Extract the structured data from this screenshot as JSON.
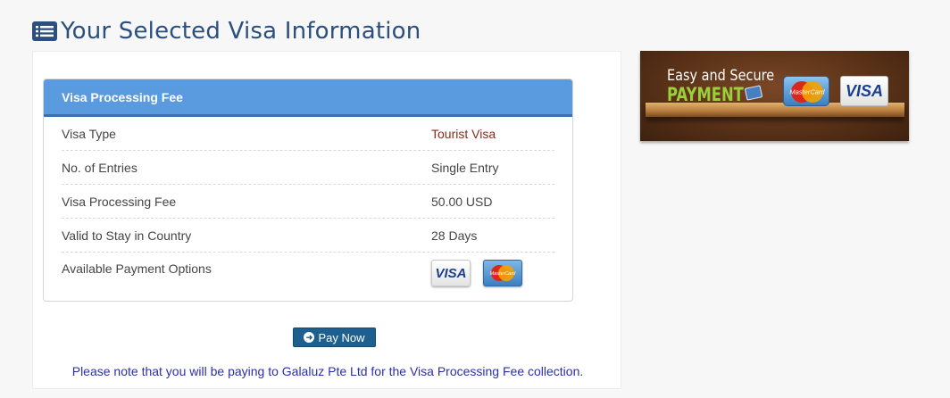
{
  "page": {
    "title": "Your Selected Visa Information"
  },
  "panel": {
    "header": "Visa Processing Fee",
    "rows": [
      {
        "label": "Visa Type",
        "value": "Tourist Visa"
      },
      {
        "label": "No. of Entries",
        "value": "Single Entry"
      },
      {
        "label": "Visa Processing Fee",
        "value": "50.00 USD"
      },
      {
        "label": "Valid to Stay in Country",
        "value": "28 Days"
      },
      {
        "label": "Available Payment Options",
        "value": ""
      }
    ],
    "payment_options": [
      {
        "name": "VISA",
        "icon": "visa-card-icon"
      },
      {
        "name": "MasterCard",
        "icon": "mastercard-icon"
      }
    ]
  },
  "actions": {
    "pay_now_label": "Pay Now"
  },
  "note": "Please note that you will be paying to Galaluz Pte Ltd for the Visa Processing Fee collection.",
  "banner": {
    "line1": "Easy and Secure",
    "line2": "PAYMENT",
    "mastercard_text": "MasterCard",
    "visa_text": "VISA"
  },
  "colors": {
    "title": "#2b4f7e",
    "panel_header_bg": "#5a9be0",
    "accent_value": "#8b2a1a",
    "button_bg": "#1d6090",
    "note_text": "#2a30a8"
  }
}
